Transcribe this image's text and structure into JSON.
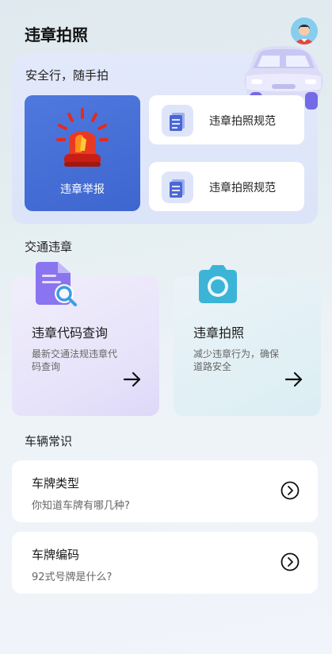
{
  "header": {
    "title": "违章拍照",
    "avatar_icon": "user-avatar-icon"
  },
  "hero": {
    "slogan": "安全行，随手拍",
    "report_label": "违章举报",
    "rules": [
      {
        "label": "违章拍照规范",
        "icon": "document-icon"
      },
      {
        "label": "违章拍照规范",
        "icon": "document-icon"
      }
    ]
  },
  "traffic": {
    "section_title": "交通违章",
    "cards": [
      {
        "title": "违章代码查询",
        "desc": "最新交通法规违章代码查询",
        "icon": "document-search-icon"
      },
      {
        "title": "违章拍照",
        "desc": "减少违章行为，确保道路安全",
        "icon": "camera-icon"
      }
    ]
  },
  "vehicle": {
    "section_title": "车辆常识",
    "items": [
      {
        "title": "车牌类型",
        "subtitle": "你知道车牌有哪几种?"
      },
      {
        "title": "车牌编码",
        "subtitle": "92式号牌是什么?"
      }
    ]
  },
  "colors": {
    "accent": "#4f79de",
    "siren": "#e32b1e",
    "camera": "#3cb4d8",
    "doc": "#8a74f0"
  }
}
